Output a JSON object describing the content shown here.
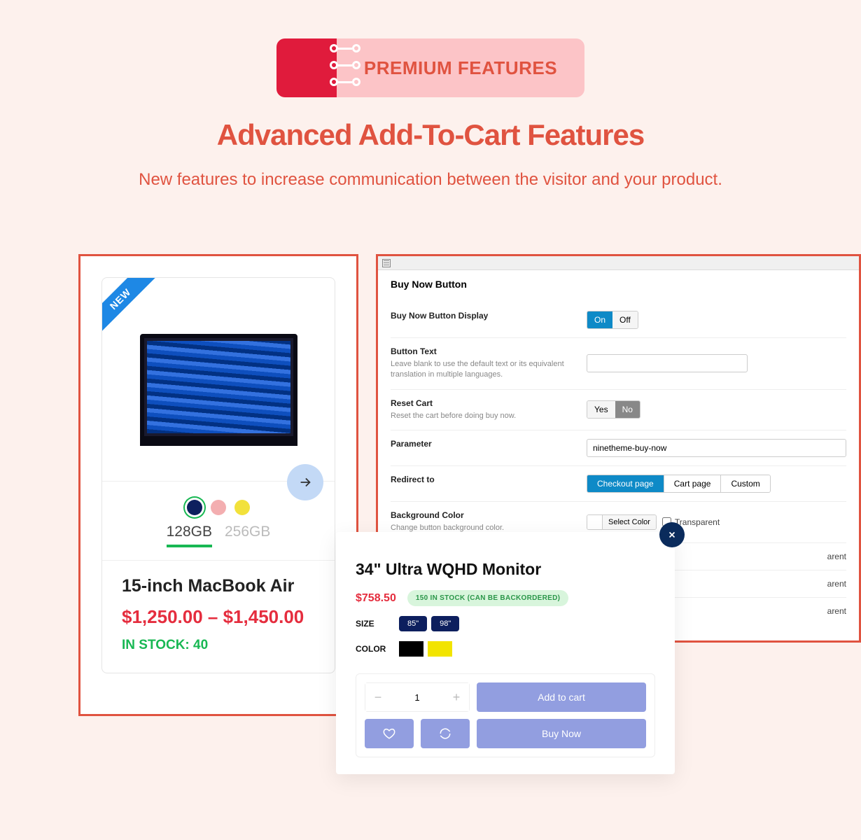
{
  "header": {
    "badge": "PREMIUM FEATURES",
    "title": "Advanced Add-To-Cart Features",
    "subtitle": "New features to increase communication between the visitor and your product."
  },
  "product": {
    "ribbon": "NEW",
    "name": "15-inch MacBook Air",
    "price_low": "$1,250.00",
    "price_sep": " – ",
    "price_high": "$1,450.00",
    "stock": "IN STOCK: 40",
    "swatches": [
      "#0d1f5e",
      "#f3aeb0",
      "#f2e13b"
    ],
    "capacities": [
      "128GB",
      "256GB"
    ],
    "selected_swatch": 0,
    "selected_capacity": 0
  },
  "settings": {
    "section_title": "Buy Now Button",
    "rows": {
      "display": {
        "label": "Buy Now Button Display",
        "on": "On",
        "off": "Off"
      },
      "text": {
        "label": "Button Text",
        "help": "Leave blank to use the default text or its equivalent translation in multiple languages.",
        "value": ""
      },
      "reset": {
        "label": "Reset Cart",
        "help": "Reset the cart before doing buy now.",
        "yes": "Yes",
        "no": "No"
      },
      "param": {
        "label": "Parameter",
        "value": "ninetheme-buy-now"
      },
      "redirect": {
        "label": "Redirect to",
        "options": [
          "Checkout page",
          "Cart page",
          "Custom"
        ],
        "selected": 0
      },
      "bgcolor": {
        "label": "Background Color",
        "help": "Change button background color.",
        "select": "Select Color",
        "transparent": "Transparent"
      },
      "extra1": {
        "transparent_tail": "arent"
      },
      "extra2": {
        "transparent_tail": "arent"
      },
      "extra3": {
        "transparent_tail": "arent"
      }
    }
  },
  "popup": {
    "title": "34\" Ultra WQHD Monitor",
    "price": "$758.50",
    "stock": "150 IN STOCK (CAN BE BACKORDERED)",
    "size_label": "SIZE",
    "sizes": [
      "85\"",
      "98\""
    ],
    "color_label": "COLOR",
    "colors": [
      "#000000",
      "#f2e400"
    ],
    "qty": "1",
    "add_to_cart": "Add to cart",
    "buy_now": "Buy Now"
  }
}
